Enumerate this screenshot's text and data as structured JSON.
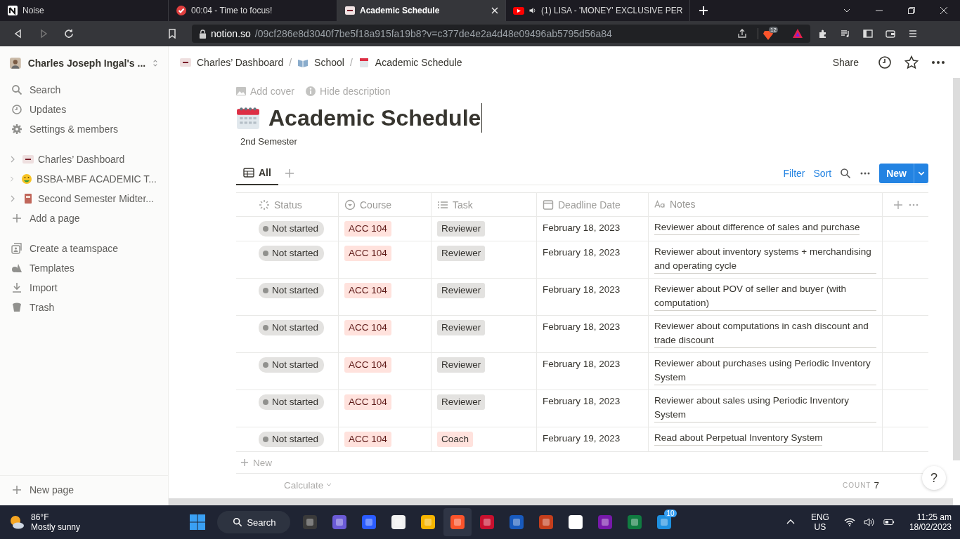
{
  "browser": {
    "tabs": [
      {
        "title": "Noise",
        "kind": "notion",
        "selected": false
      },
      {
        "title": "00:04 - Time to focus!",
        "kind": "check",
        "selected": false
      },
      {
        "title": "Academic Schedule",
        "kind": "page",
        "selected": true
      },
      {
        "title": "(1) LISA - 'MONEY' EXCLUSIVE PER",
        "kind": "video",
        "selected": false
      }
    ],
    "address": {
      "host": "notion.so",
      "path": "/09cf286e8d3040f7be5f18a915fa19b8?v=c377de4e2a4d48e09496ab5795d56a84"
    },
    "shield_count": "12"
  },
  "sidebar": {
    "workspace": "Charles Joseph Ingal's ...",
    "nav": [
      {
        "label": "Search",
        "kind": "search"
      },
      {
        "label": "Updates",
        "kind": "clock"
      },
      {
        "label": "Settings & members",
        "kind": "gear"
      }
    ],
    "pages": [
      {
        "title": "Charles’ Dashboard",
        "kind": "banner"
      },
      {
        "title": "BSBA-MBF ACADEMIC T...",
        "kind": "emoji"
      },
      {
        "title": "Second Semester Midter...",
        "kind": "book"
      }
    ],
    "add_page": "Add a page",
    "tools": [
      {
        "label": "Create a teamspace",
        "kind": "team"
      },
      {
        "label": "Templates",
        "kind": "shapes"
      },
      {
        "label": "Import",
        "kind": "download"
      },
      {
        "label": "Trash",
        "kind": "trash"
      }
    ],
    "new_page": "New page"
  },
  "breadcrumb": [
    {
      "title": "Charles’ Dashboard",
      "kind": "banner",
      "separator": "/"
    },
    {
      "title": "School",
      "kind": "book",
      "separator": "/"
    },
    {
      "title": "Academic Schedule",
      "kind": "calendar"
    }
  ],
  "share": "Share",
  "page": {
    "add_cover": "Add cover",
    "hide_description": "Hide description",
    "title": "Academic Schedule",
    "description": "2nd Semester"
  },
  "views": [
    {
      "label": "All",
      "selected": true
    }
  ],
  "actions": {
    "filter": "Filter",
    "sort": "Sort",
    "new": "New"
  },
  "table": {
    "columns": [
      {
        "label": "Status",
        "kind": "status"
      },
      {
        "label": "Course",
        "kind": "select"
      },
      {
        "label": "Task",
        "kind": "list"
      },
      {
        "label": "Deadline Date",
        "kind": "date"
      },
      {
        "label": "Notes",
        "kind": "title"
      }
    ],
    "rows": [
      {
        "status": "Not started",
        "course": {
          "text": "ACC 104",
          "color": "#ffe2dd"
        },
        "task": {
          "text": "Reviewer",
          "color": "#e3e2e0"
        },
        "deadline": "February 18, 2023",
        "notes": "Reviewer about difference of sales and purchase"
      },
      {
        "status": "Not started",
        "course": {
          "text": "ACC 104",
          "color": "#ffe2dd"
        },
        "task": {
          "text": "Reviewer",
          "color": "#e3e2e0"
        },
        "deadline": "February 18, 2023",
        "notes": "Reviewer about inventory systems + merchandising and operating cycle"
      },
      {
        "status": "Not started",
        "course": {
          "text": "ACC 104",
          "color": "#ffe2dd"
        },
        "task": {
          "text": "Reviewer",
          "color": "#e3e2e0"
        },
        "deadline": "February 18, 2023",
        "notes": "Reviewer about POV of seller and buyer (with computation)"
      },
      {
        "status": "Not started",
        "course": {
          "text": "ACC 104",
          "color": "#ffe2dd"
        },
        "task": {
          "text": "Reviewer",
          "color": "#e3e2e0"
        },
        "deadline": "February 18, 2023",
        "notes": "Reviewer about computations in cash discount and trade discount"
      },
      {
        "status": "Not started",
        "course": {
          "text": "ACC 104",
          "color": "#ffe2dd"
        },
        "task": {
          "text": "Reviewer",
          "color": "#e3e2e0"
        },
        "deadline": "February 18, 2023",
        "notes": "Reviewer about purchases using Periodic Inventory System"
      },
      {
        "status": "Not started",
        "course": {
          "text": "ACC 104",
          "color": "#ffe2dd"
        },
        "task": {
          "text": "Reviewer",
          "color": "#e3e2e0"
        },
        "deadline": "February 18, 2023",
        "notes": "Reviewer about sales using Periodic Inventory System"
      },
      {
        "status": "Not started",
        "course": {
          "text": "ACC 104",
          "color": "#ffe2dd"
        },
        "task": {
          "text": "Coach",
          "color": "#ffe2dd"
        },
        "deadline": "February 19, 2023",
        "notes": "Read about Perpetual Inventory System"
      }
    ],
    "add_row": "New",
    "calculate": "Calculate",
    "count_label": "COUNT",
    "count": "7"
  },
  "help": "?",
  "taskbar": {
    "temperature": "86°F",
    "weather": "Mostly sunny",
    "search": "Search",
    "badge": "10",
    "language": "ENG",
    "region": "US",
    "time": "11:25 am",
    "date": "18/02/2023"
  }
}
